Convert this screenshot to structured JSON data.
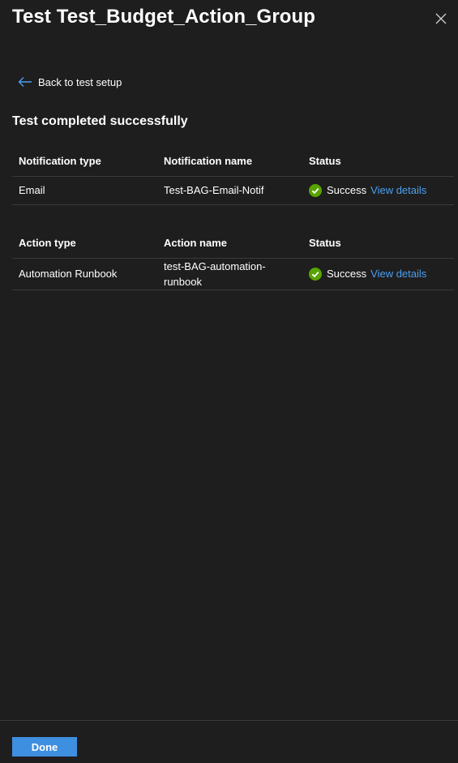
{
  "panel": {
    "title": "Test Test_Budget_Action_Group",
    "close_icon": "close-icon"
  },
  "back_link": {
    "label": "Back to test setup",
    "icon": "arrow-left-icon"
  },
  "heading": "Test completed successfully",
  "notifications_table": {
    "headers": [
      "Notification type",
      "Notification name",
      "Status"
    ],
    "rows": [
      {
        "type": "Email",
        "name": "Test-BAG-Email-Notif",
        "status": "Success",
        "link": "View details"
      }
    ]
  },
  "actions_table": {
    "headers": [
      "Action type",
      "Action name",
      "Status"
    ],
    "rows": [
      {
        "type": "Automation Runbook",
        "name": "test-BAG-automation-runbook",
        "status": "Success",
        "link": "View details"
      }
    ]
  },
  "footer": {
    "done_label": "Done"
  },
  "colors": {
    "background": "#1f1e1e",
    "accent": "#3e8fe0",
    "link": "#4aa0f0",
    "success": "#57a300",
    "divider": "#3b3a39"
  }
}
